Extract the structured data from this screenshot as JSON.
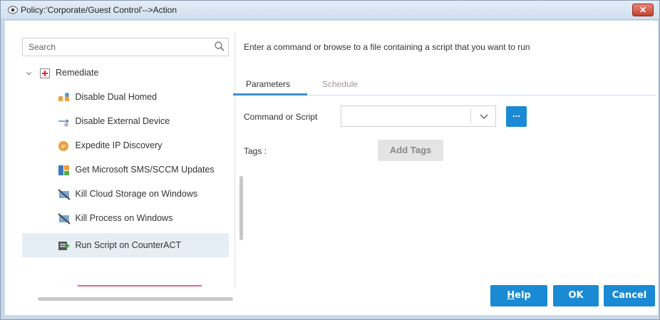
{
  "window": {
    "title": "Policy:'Corporate/Guest Control'-->Action",
    "close_label": "✕"
  },
  "sidebar": {
    "search_placeholder": "Search",
    "group_label": "Remediate",
    "items": [
      {
        "label": "Disable Dual Homed"
      },
      {
        "label": "Disable External Device"
      },
      {
        "label": "Expedite IP Discovery"
      },
      {
        "label": "Get Microsoft SMS/SCCM Updates"
      },
      {
        "label": "Kill Cloud Storage on Windows"
      },
      {
        "label": "Kill Process on Windows"
      },
      {
        "label": "Run Script on CounterACT",
        "selected": true
      }
    ]
  },
  "main": {
    "instruction": "Enter a command or browse to a file containing a script that you want to run",
    "tabs": [
      {
        "label": "Parameters",
        "active": true
      },
      {
        "label": "Schedule",
        "active": false
      }
    ],
    "command_label": "Command or Script",
    "command_value": "",
    "browse_label": "...",
    "tags_label": "Tags :",
    "add_tags_label": "Add Tags"
  },
  "footer": {
    "help_label_first": "H",
    "help_label_rest": "elp",
    "ok_label": "OK",
    "cancel_label": "Cancel"
  },
  "colors": {
    "accent": "#1a8ad4",
    "selection_bg": "#e5edf5",
    "selection_underline": "#e06a82"
  }
}
